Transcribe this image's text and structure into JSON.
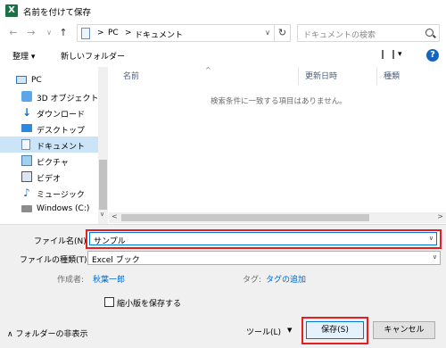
{
  "window": {
    "title": "名前を付けて保存",
    "app_icon": "X"
  },
  "nav": {
    "back": "←",
    "forward": "→",
    "recent": "∨",
    "up": "↑",
    "path": [
      "PC",
      "ドキュメント"
    ],
    "sep": ">",
    "refresh": "↻",
    "search_placeholder": "ドキュメントの検索"
  },
  "toolbar": {
    "organize": "整理 ▾",
    "new_folder": "新しいフォルダー",
    "view": "▾",
    "help": "?"
  },
  "sidebar": {
    "items": [
      {
        "label": "PC",
        "icon": "pc-icon"
      },
      {
        "label": "3D オブジェクト",
        "icon": "3d-objects-icon"
      },
      {
        "label": "ダウンロード",
        "icon": "download-icon"
      },
      {
        "label": "デスクトップ",
        "icon": "desktop-icon"
      },
      {
        "label": "ドキュメント",
        "icon": "document-icon"
      },
      {
        "label": "ピクチャ",
        "icon": "pictures-icon"
      },
      {
        "label": "ビデオ",
        "icon": "video-icon"
      },
      {
        "label": "ミュージック",
        "icon": "music-icon"
      },
      {
        "label": "Windows (C:)",
        "icon": "drive-icon"
      }
    ]
  },
  "file_list": {
    "columns": [
      "名前",
      "更新日時",
      "種類"
    ],
    "empty_message": "検索条件に一致する項目はありません。"
  },
  "form": {
    "filename_label": "ファイル名(N):",
    "filename_value": "サンプル",
    "filetype_label": "ファイルの種類(T):",
    "filetype_value": "Excel ブック",
    "author_label": "作成者:",
    "author_value": "秋葉一郎",
    "tags_label": "タグ:",
    "tags_value": "タグの追加",
    "thumbnail_label": "縮小版を保存する",
    "hide_folders": "フォルダーの非表示",
    "tools": "ツール(L)",
    "save": "保存(S)",
    "cancel": "キャンセル"
  }
}
